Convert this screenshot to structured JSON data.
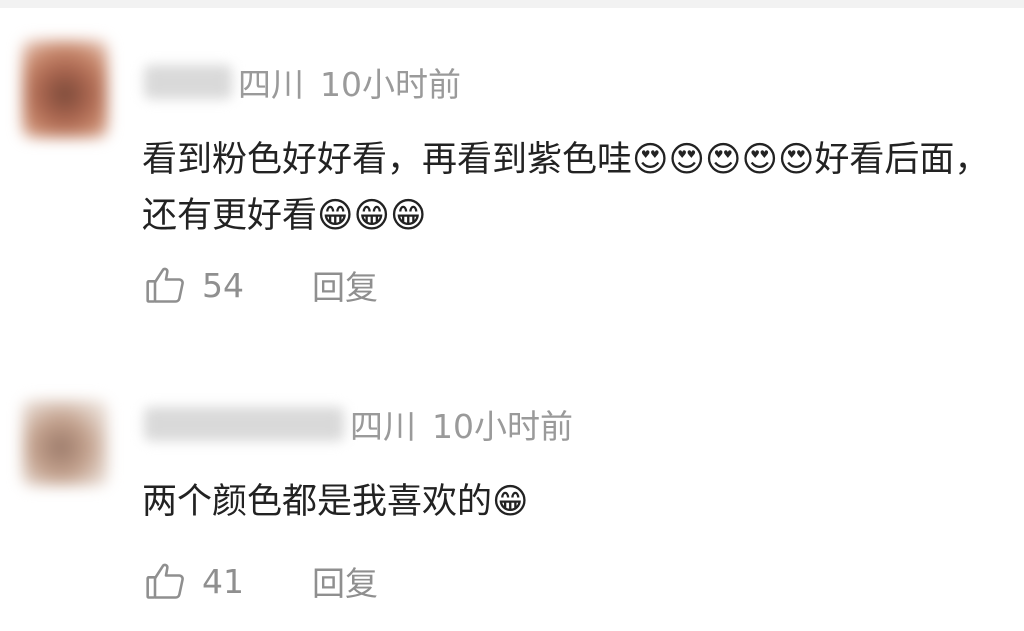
{
  "comments": [
    {
      "location": "四川",
      "time": "10小时前",
      "text": "看到粉色好好看，再看到紫色哇😍😍😍😍😍好看后面，还有更好看😁😁😁",
      "likes": "54",
      "reply_label": "回复"
    },
    {
      "location": "四川",
      "time": "10小时前",
      "text": "两个颜色都是我喜欢的😁",
      "likes": "41",
      "reply_label": "回复"
    }
  ],
  "icons": {
    "like": "thumbs-up-icon"
  }
}
